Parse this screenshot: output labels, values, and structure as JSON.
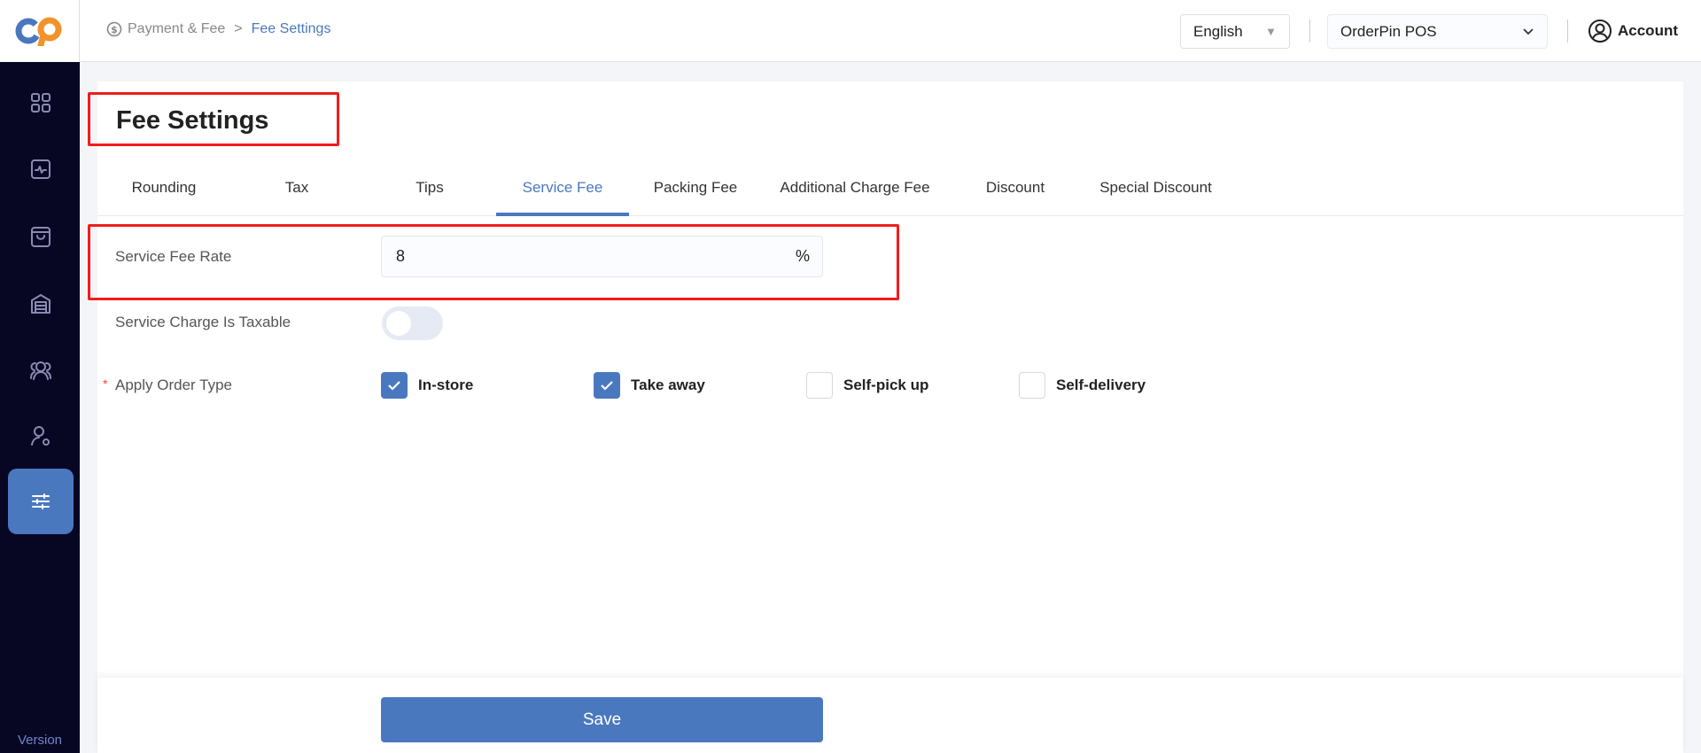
{
  "header": {
    "breadcrumb": [
      "Payment & Fee",
      "Fee Settings"
    ],
    "language": "English",
    "store": "OrderPin POS",
    "account": "Account"
  },
  "sidebar": {
    "items": [
      {
        "icon": "dashboard-icon"
      },
      {
        "icon": "activity-icon"
      },
      {
        "icon": "shopping-bag-icon"
      },
      {
        "icon": "warehouse-icon"
      },
      {
        "icon": "users-icon"
      },
      {
        "icon": "user-settings-icon"
      },
      {
        "icon": "sliders-icon",
        "active": true
      }
    ],
    "version": "Version"
  },
  "page": {
    "title": "Fee Settings",
    "tabs": [
      "Rounding",
      "Tax",
      "Tips",
      "Service Fee",
      "Packing Fee",
      "Additional Charge Fee",
      "Discount",
      "Special Discount"
    ],
    "active_tab": "Service Fee",
    "service_fee_rate": {
      "label": "Service Fee Rate",
      "value": "8",
      "unit": "%"
    },
    "taxable": {
      "label": "Service Charge Is Taxable",
      "on": false
    },
    "order_type": {
      "label": "Apply Order Type",
      "required": "*",
      "options": [
        {
          "label": "In-store",
          "checked": true
        },
        {
          "label": "Take away",
          "checked": true
        },
        {
          "label": "Self-pick up",
          "checked": false
        },
        {
          "label": "Self-delivery",
          "checked": false
        }
      ]
    },
    "save": "Save"
  },
  "colors": {
    "accent": "#4a78bf",
    "sidebar": "#070723",
    "highlight": "#f21c1c"
  }
}
